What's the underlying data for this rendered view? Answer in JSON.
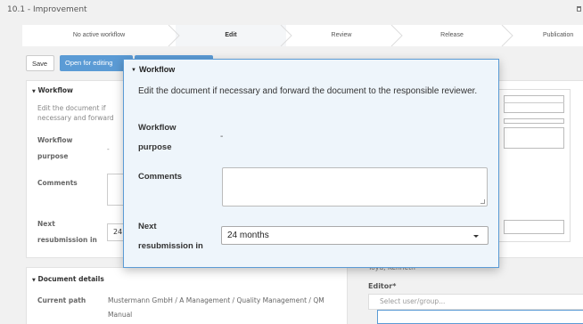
{
  "window": {
    "title": "10.1 - Improvement"
  },
  "steps": [
    {
      "label": "No active workflow"
    },
    {
      "label": "Edit"
    },
    {
      "label": "Review"
    },
    {
      "label": "Release"
    },
    {
      "label": "Publication"
    }
  ],
  "toolbar": {
    "save_label": "Save",
    "open_label": "Open for editing"
  },
  "bg_workflow": {
    "header": "Workflow",
    "description": "Edit the document if necessary and forward the document to the responsible reviewer.",
    "workflow_label": "Workflow",
    "purpose_label": "purpose",
    "purpose_value": "-",
    "comments_label": "Comments",
    "next_label": "Next",
    "resub_label": "resubmission in",
    "next_value": "24"
  },
  "document_details": {
    "header": "Document details",
    "current_path_label": "Current path",
    "current_path_value": "Mustermann GmbH / A Management / Quality Management / QM",
    "current_path_value2": "Manual"
  },
  "right_panel": {
    "person": "Toyu, Kenneth",
    "editor_label": "Editor*",
    "editor_placeholder": "Select user/group..."
  },
  "popup": {
    "header": "Workflow",
    "description": "Edit the document if necessary and forward the document to the responsible reviewer.",
    "workflow_label": "Workflow",
    "purpose_label": "purpose",
    "purpose_value": "-",
    "comments_label": "Comments",
    "comments_value": "",
    "next_label": "Next",
    "resub_label": "resubmission in",
    "next_value": "24 months"
  },
  "colors": {
    "accent": "#5b9bd5",
    "popup_bg": "#eef5fb"
  }
}
